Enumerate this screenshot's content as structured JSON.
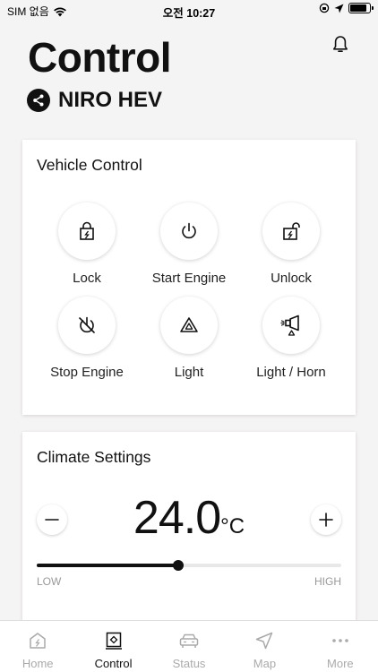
{
  "status_bar": {
    "carrier": "SIM 없음",
    "time": "오전 10:27",
    "battery_level": 0.85
  },
  "header": {
    "title": "Control",
    "vehicle_name": "NIRO HEV",
    "notification_icon": "bell-icon",
    "share_icon": "share-icon"
  },
  "vehicle_control": {
    "title": "Vehicle Control",
    "buttons": [
      {
        "label": "Lock",
        "icon": "lock-icon"
      },
      {
        "label": "Start Engine",
        "icon": "power-icon"
      },
      {
        "label": "Unlock",
        "icon": "unlock-icon"
      },
      {
        "label": "Stop Engine",
        "icon": "stop-engine-icon"
      },
      {
        "label": "Light",
        "icon": "hazard-light-icon"
      },
      {
        "label": "Light / Horn",
        "icon": "horn-icon"
      }
    ]
  },
  "climate": {
    "title": "Climate Settings",
    "temperature": "24.0",
    "unit": "°C",
    "slider_level": 0.465,
    "low_label": "LOW",
    "high_label": "HIGH"
  },
  "tabs": [
    {
      "label": "Home",
      "icon": "home-icon",
      "active": false
    },
    {
      "label": "Control",
      "icon": "control-icon",
      "active": true
    },
    {
      "label": "Status",
      "icon": "car-icon",
      "active": false
    },
    {
      "label": "Map",
      "icon": "navigation-icon",
      "active": false
    },
    {
      "label": "More",
      "icon": "more-icon",
      "active": false
    }
  ],
  "colors": {
    "background": "#f5f4f4",
    "primary": "#111111",
    "inactive_tab": "#aaaaaa"
  }
}
